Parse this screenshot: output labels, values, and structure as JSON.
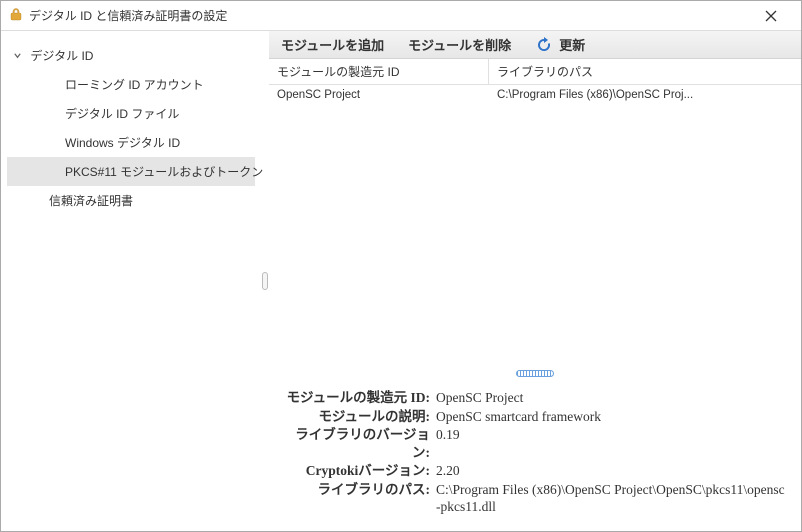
{
  "window": {
    "title": "デジタル ID と信頼済み証明書の設定"
  },
  "sidebar": {
    "root": "デジタル ID",
    "items": [
      "ローミング ID アカウント",
      "デジタル ID ファイル",
      "Windows デジタル ID",
      "PKCS#11 モジュールおよびトークン"
    ],
    "trusted": "信頼済み証明書"
  },
  "toolbar": {
    "add": "モジュールを追加",
    "remove": "モジュールを削除",
    "refresh": "更新"
  },
  "table": {
    "headers": [
      "モジュールの製造元 ID",
      "ライブラリのパス"
    ],
    "rows": [
      {
        "vendor": "OpenSC Project",
        "path": "C:\\Program Files (x86)\\OpenSC Proj..."
      }
    ]
  },
  "details": {
    "rows": [
      {
        "label": "モジュールの製造元 ID:",
        "value": "OpenSC Project"
      },
      {
        "label": "モジュールの説明:",
        "value": "OpenSC smartcard framework"
      },
      {
        "label": "ライブラリのバージョン:",
        "value": "0.19"
      },
      {
        "label": "Cryptokiバージョン:",
        "value": "2.20"
      },
      {
        "label": "ライブラリのパス:",
        "value": "C:\\Program Files (x86)\\OpenSC Project\\OpenSC\\pkcs11\\opensc-pkcs11.dll"
      }
    ]
  }
}
